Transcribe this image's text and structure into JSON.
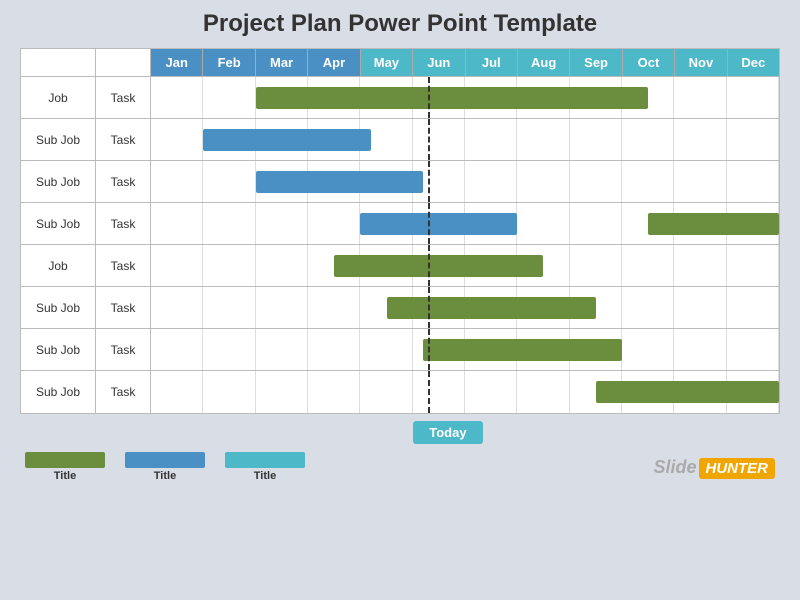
{
  "title": "Project Plan Power Point Template",
  "months": [
    "Jan",
    "Feb",
    "Mar",
    "Apr",
    "May",
    "Jun",
    "Jul",
    "Aug",
    "Sep",
    "Oct",
    "Nov",
    "Dec"
  ],
  "rows": [
    {
      "label": "Job",
      "task": "Task",
      "bar": {
        "color": "green",
        "start": 2,
        "end": 9.5
      }
    },
    {
      "label": "Sub Job",
      "task": "Task",
      "bar": {
        "color": "blue",
        "start": 1,
        "end": 4.2
      }
    },
    {
      "label": "Sub Job",
      "task": "Task",
      "bar": {
        "color": "blue",
        "start": 2,
        "end": 5.2
      }
    },
    {
      "label": "Sub Job",
      "task": "Task",
      "bar": {
        "color": "blue",
        "start": 4,
        "end": 7.0
      },
      "bar2": {
        "color": "green",
        "start": 9.5,
        "end": 12
      }
    },
    {
      "label": "Job",
      "task": "Task",
      "bar": {
        "color": "green",
        "start": 3.5,
        "end": 7.5
      }
    },
    {
      "label": "Sub Job",
      "task": "Task",
      "bar": {
        "color": "green",
        "start": 4.5,
        "end": 8.5
      }
    },
    {
      "label": "Sub Job",
      "task": "Task",
      "bar": {
        "color": "green",
        "start": 5.2,
        "end": 9.0
      }
    },
    {
      "label": "Sub Job",
      "task": "Task",
      "bar": {
        "color": "green",
        "start": 8.5,
        "end": 12
      }
    }
  ],
  "today_label": "Today",
  "today_position": 5.3,
  "legend": [
    {
      "color": "#6b8e3e",
      "label": "Title"
    },
    {
      "color": "#4a90c4",
      "label": "Title"
    },
    {
      "color": "#4db8c8",
      "label": "Title"
    }
  ],
  "brand": {
    "slide": "Slide",
    "hunter": "HUNTER"
  }
}
